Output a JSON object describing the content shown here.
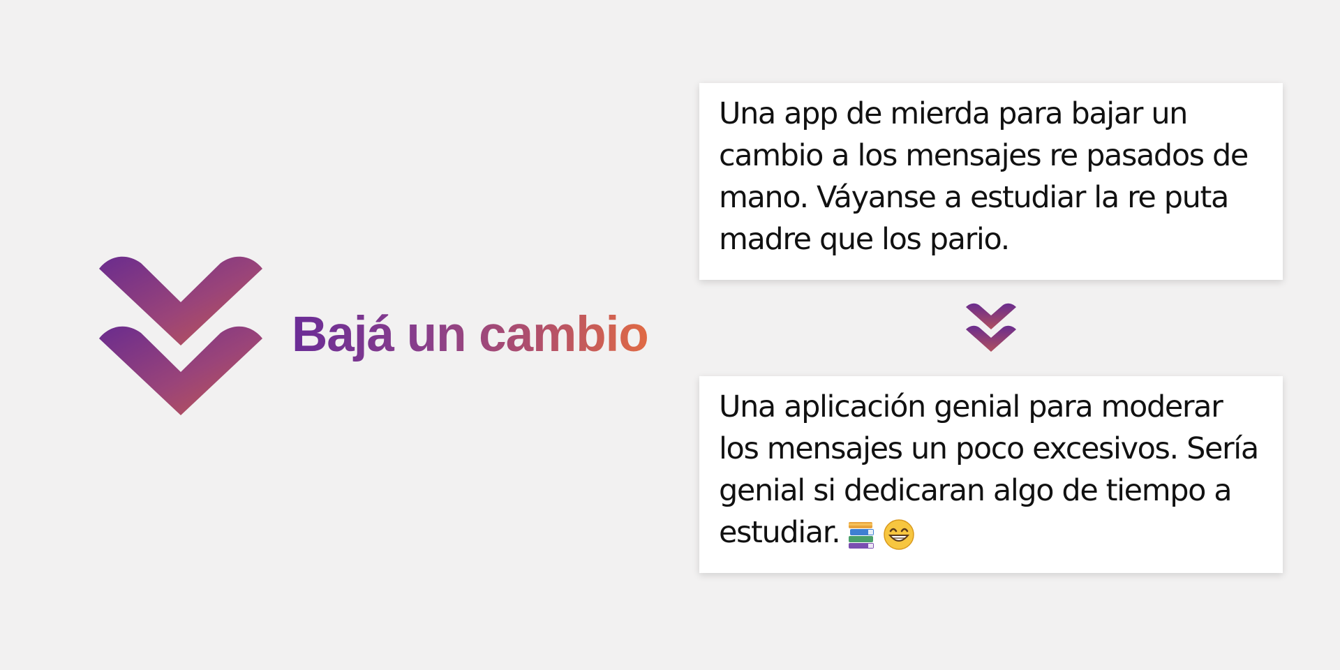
{
  "brand": {
    "name": "Bajá un cambio",
    "logo_icon": "double-chevron-down-icon",
    "gradient": [
      "#6a2c96",
      "#b2506a",
      "#e06a44"
    ]
  },
  "background_color": "#f2f1f1",
  "original_message": {
    "text": "Una app de mierda para bajar un cambio a los mensajes re pasados de mano. Váyanse a estudiar la re puta madre que los pario."
  },
  "transform_arrow": {
    "icon": "double-chevron-down-icon"
  },
  "rewritten_message": {
    "text": "Una aplicación genial para moderar los mensajes un poco excesivos. Sería genial si dedicaran algo de tiempo a estudiar.",
    "emojis": [
      "books-icon",
      "grinning-face-icon"
    ]
  }
}
